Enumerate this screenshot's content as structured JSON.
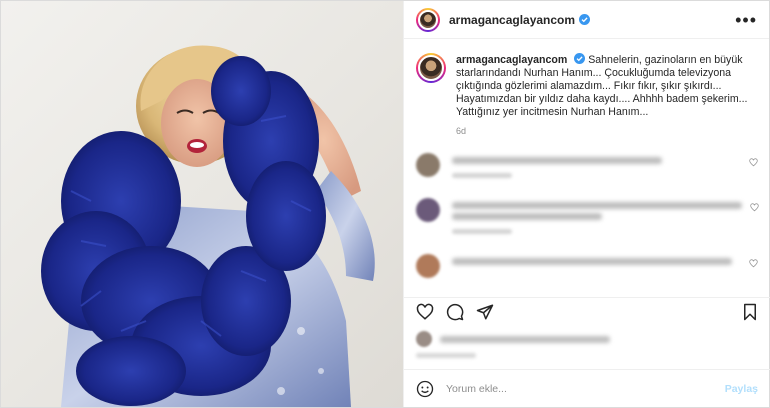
{
  "post": {
    "username": "armagancaglayancom",
    "caption_username": "armagancaglayancom",
    "caption_text": "Sahnelerin, gazinoların en büyük starlarındandı Nurhan Hanım... Çocukluğumda televizyona çıktığında gözlerimi alamazdım... Fıkır fıkır, şıkır şıkırdı... Hayatımızdan bir yıldız daha kaydı.... Ahhhh badem şekerim... Yattığınız yer incitmesin Nurhan Hanım...",
    "age": "6d"
  },
  "add_comment": {
    "placeholder": "Yorum ekle...",
    "post_label": "Paylaş"
  },
  "colors": {
    "verified": "#3897f0",
    "feather_blue": "#1d2a8c",
    "link_disabled": "#b2dffc"
  },
  "icons": [
    "verified-badge-icon",
    "more-options-icon",
    "emoji-icon",
    "heart-icon",
    "comment-icon",
    "share-icon",
    "save-icon"
  ]
}
